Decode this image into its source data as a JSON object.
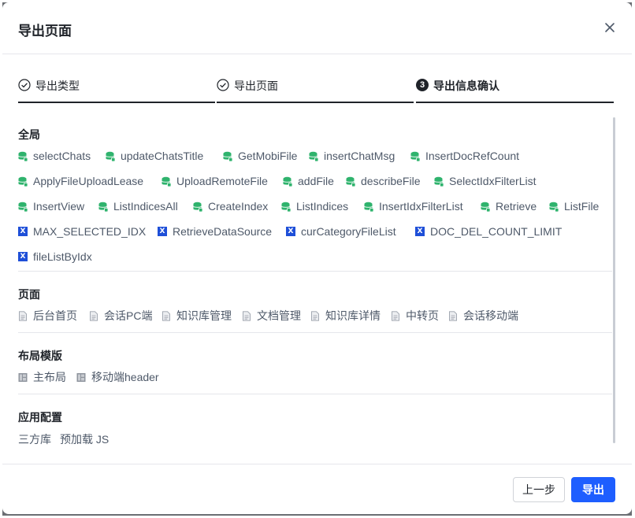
{
  "modal": {
    "title": "导出页面",
    "close_icon": "close-icon"
  },
  "steps": [
    {
      "label": "导出类型",
      "icon": "check-circle-icon",
      "status": "done"
    },
    {
      "label": "导出页面",
      "icon": "check-circle-icon",
      "status": "done"
    },
    {
      "label": "导出信息确认",
      "number": "3",
      "status": "current"
    }
  ],
  "sections": {
    "global": {
      "title": "全局",
      "datasources": [
        "selectChats",
        "updateChatsTitle",
        "GetMobiFile",
        "insertChatMsg",
        "InsertDocRefCount",
        "ApplyFileUploadLease",
        "UploadRemoteFile",
        "addFile",
        "describeFile",
        "SelectIdxFilterList",
        "InsertView",
        "ListIndicesAll",
        "CreateIndex",
        "ListIndices",
        "InsertIdxFilterList",
        "Retrieve",
        "ListFile"
      ],
      "variables": [
        "MAX_SELECTED_IDX",
        "RetrieveDataSource",
        "curCategoryFileList",
        "DOC_DEL_COUNT_LIMIT",
        "fileListByIdx"
      ],
      "variable_badge": "X",
      "datasource_color": "#2fb36d",
      "variable_color": "#1e4fd8"
    },
    "pages": {
      "title": "页面",
      "items": [
        "后台首页",
        "会话PC端",
        "知识库管理",
        "文档管理",
        "知识库详情",
        "中转页",
        "会话移动端"
      ]
    },
    "layouts": {
      "title": "布局模版",
      "items": [
        "主布局",
        "移动端header"
      ]
    },
    "app_config": {
      "title": "应用配置",
      "items": [
        "三方库",
        "预加载 JS"
      ]
    }
  },
  "footer": {
    "prev_label": "上一步",
    "export_label": "导出",
    "accent_color": "#1e5eff"
  }
}
